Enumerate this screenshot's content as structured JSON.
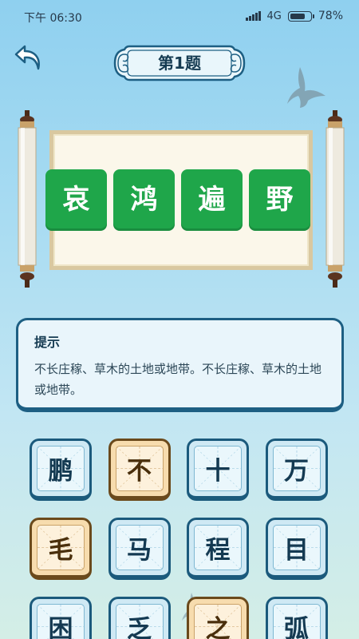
{
  "status_bar": {
    "time": "下午 06:30",
    "network": "4G",
    "battery_percent": "78%",
    "battery_level": 0.78
  },
  "header": {
    "back_icon": "back-arrow-icon",
    "title": "第1题"
  },
  "answer": {
    "characters": [
      "哀",
      "鸿",
      "遍",
      "野"
    ],
    "tile_color": "#1fa64a"
  },
  "hint": {
    "title": "提示",
    "text": "不长庄稼、草木的土地或地带。不长庄稼、草木的土地或地带。"
  },
  "candidates": [
    {
      "char": "鹏",
      "style": "blue"
    },
    {
      "char": "不",
      "style": "tan"
    },
    {
      "char": "十",
      "style": "blue"
    },
    {
      "char": "万",
      "style": "blue"
    },
    {
      "char": "毛",
      "style": "tan"
    },
    {
      "char": "马",
      "style": "blue"
    },
    {
      "char": "程",
      "style": "blue"
    },
    {
      "char": "目",
      "style": "blue"
    },
    {
      "char": "困",
      "style": "blue"
    },
    {
      "char": "乏",
      "style": "blue"
    },
    {
      "char": "之",
      "style": "tan"
    },
    {
      "char": "弧",
      "style": "blue"
    }
  ],
  "colors": {
    "accent_dark": "#1d5f83",
    "answer_green": "#1fa64a",
    "tile_tan": "#f7dcae"
  }
}
